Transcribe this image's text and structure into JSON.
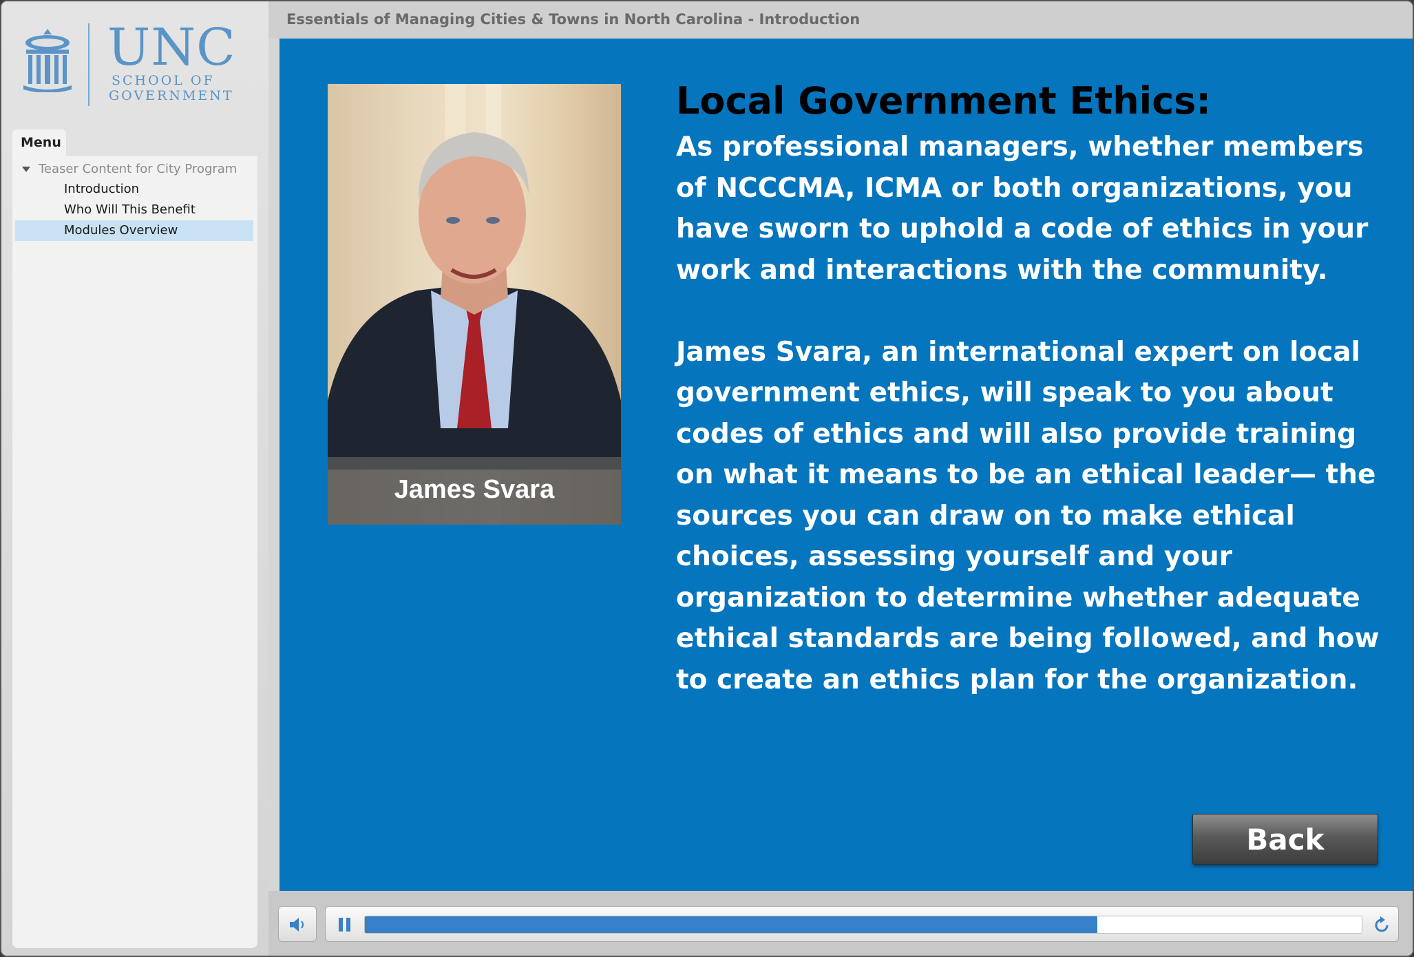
{
  "colors": {
    "slide_background": "#0575be",
    "brand_blue": "#5b94c6",
    "active_menu": "#c8e2f3",
    "progress": "#3580c8"
  },
  "logo": {
    "name": "UNC",
    "line1": "SCHOOL OF",
    "line2": "GOVERNMENT",
    "icon": "old-well-icon"
  },
  "header": {
    "course_title": "Essentials of Managing Cities & Towns in North Carolina - Introduction"
  },
  "menu": {
    "tab_label": "Menu",
    "parent": {
      "label": "Teaser Content for City Program",
      "expanded": true
    },
    "items": [
      {
        "label": "Introduction",
        "active": false
      },
      {
        "label": "Who Will This Benefit",
        "active": false
      },
      {
        "label": "Modules Overview",
        "active": true
      }
    ]
  },
  "slide": {
    "photo_caption": "James Svara",
    "heading": "Local Government Ethics:",
    "paragraphs": [
      "As professional managers, whether members of NCCCMA, ICMA or both organizations, you have sworn to uphold a code of ethics in your work and interactions with the community.",
      "James Svara, an international expert on local government ethics, will speak to you about codes of ethics and will also provide training on what it means to be an ethical leader— the sources you can draw on to make ethical choices, assessing yourself and your organization to determine whether adequate ethical standards are being followed, and how to create an ethics plan for the organization."
    ],
    "back_label": "Back"
  },
  "player": {
    "progress_percent": 73.5,
    "icons": [
      "volume-icon",
      "pause-icon",
      "replay-icon"
    ]
  }
}
